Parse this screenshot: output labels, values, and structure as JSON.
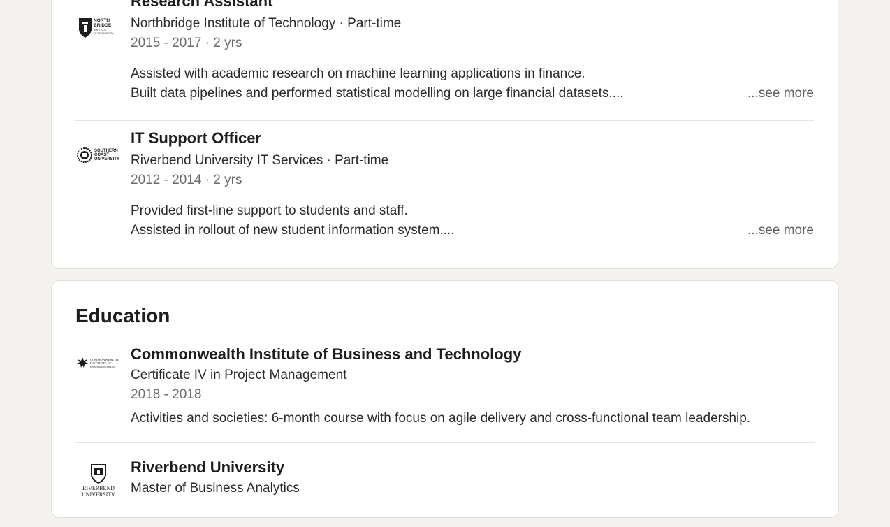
{
  "experience": {
    "items": [
      {
        "logo_text": [
          "NORTH",
          "BRIDGE",
          "INSTITUTE",
          "OF TECHNOLOGY"
        ],
        "title": "Research Assistant",
        "subtitle": "Northbridge Institute of Technology · Part-time",
        "dates": "2015 - 2017 · 2 yrs",
        "desc_line1": "Assisted with academic research on machine learning applications in finance.",
        "desc_line2": "Built data pipelines and performed statistical modelling on large financial datasets....",
        "see_more": "...see more"
      },
      {
        "logo_text": [
          "SOUTHERN",
          "COAST",
          "UNIVERSITY"
        ],
        "title": "IT Support Officer",
        "subtitle": "Riverbend University IT Services · Part-time",
        "dates": "2012 - 2014 · 2 yrs",
        "desc_line1": "Provided first-line support to students and staff.",
        "desc_line2": "Assisted in rollout of new student information system....",
        "see_more": "...see more"
      }
    ]
  },
  "education": {
    "heading": "Education",
    "items": [
      {
        "logo_text": [
          "COMMONWEALTH",
          "INSTITUTE OF",
          "BUSINESS AND TECHNOLOGY"
        ],
        "title": "Commonwealth Institute of Business and Technology",
        "subtitle": "Certificate IV in Project Management",
        "dates": "2018 - 2018",
        "activities": "Activities and societies: 6-month course with focus on agile delivery and cross-functional team leadership."
      },
      {
        "logo_text": [
          "RIVERBEND",
          "UNIVERSITY"
        ],
        "title": "Riverbend University",
        "subtitle": "Master of Business Analytics"
      }
    ]
  }
}
